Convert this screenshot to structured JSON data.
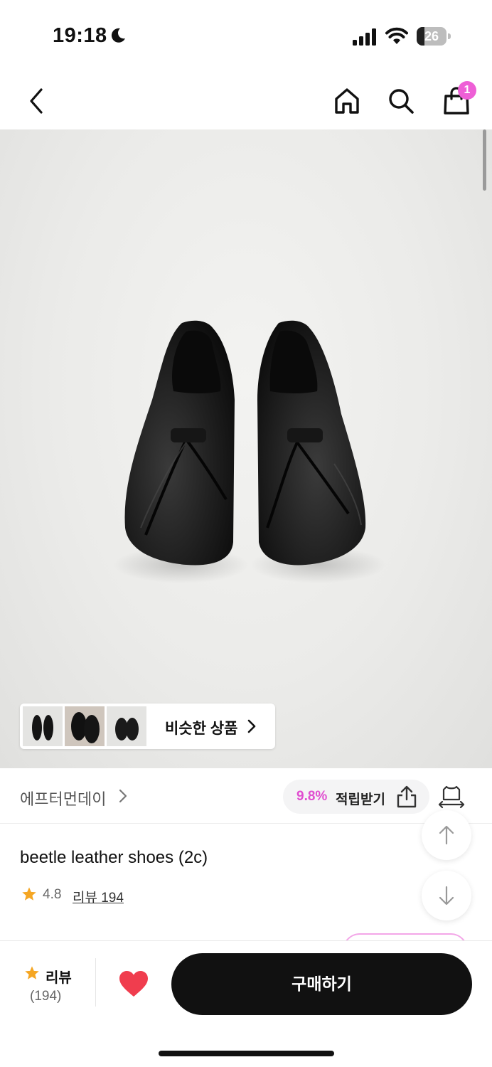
{
  "status_bar": {
    "time": "19:18",
    "battery_level": "26",
    "icons": [
      "moon-icon",
      "signal-icon",
      "wifi-icon",
      "battery-icon"
    ]
  },
  "nav": {
    "icons": [
      "back-arrow-icon",
      "home-icon",
      "search-icon",
      "shopping-bag-icon"
    ],
    "cart_badge": "1"
  },
  "similar": {
    "label": "비슷한 상품"
  },
  "brand": {
    "name": "에프터먼데이",
    "points_percent": "9.8%",
    "points_label": "적립받기"
  },
  "product": {
    "title": "beetle leather shoes (2c)",
    "rating": "4.8",
    "review_link": "리뷰 194"
  },
  "bottom_bar": {
    "review_label": "리뷰",
    "review_count": "(194)",
    "buy_label": "구매하기"
  },
  "colors": {
    "accent_pink": "#e04ed0",
    "badge_pink": "#ee5fd6",
    "star_orange": "#f5a623",
    "heart_red": "#f03d4e",
    "button_black": "#111111"
  }
}
